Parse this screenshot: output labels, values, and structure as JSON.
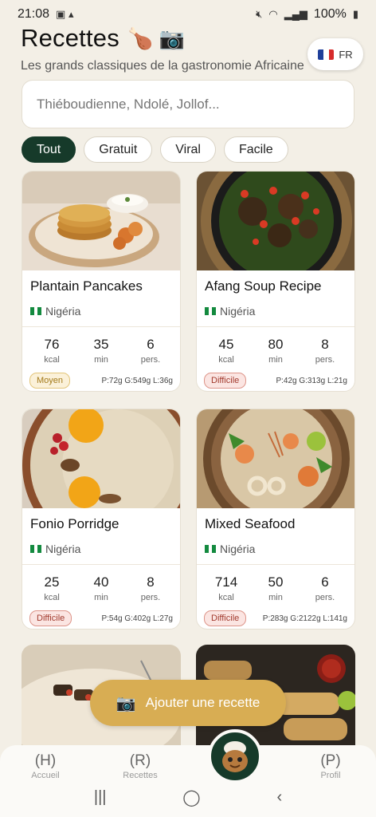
{
  "status_bar": {
    "time": "21:08",
    "battery": "100%"
  },
  "header": {
    "title": "Recettes",
    "title_emoji": "🍗 📷",
    "subtitle": "Les grands classiques de la gastronomie Africaine"
  },
  "language": {
    "code": "FR",
    "flag": "france"
  },
  "search": {
    "placeholder": "Thiéboudienne, Ndolé, Jollof..."
  },
  "filters": [
    {
      "label": "Tout",
      "active": true
    },
    {
      "label": "Gratuit",
      "active": false
    },
    {
      "label": "Viral",
      "active": false
    },
    {
      "label": "Facile",
      "active": false
    }
  ],
  "recipes": [
    {
      "name": "Plantain Pancakes",
      "origin": "Nigéria",
      "kcal": "76",
      "kcal_label": "kcal",
      "min": "35",
      "min_label": "min",
      "pers": "6",
      "pers_label": "pers.",
      "difficulty": "Moyen",
      "difficulty_level": "medium",
      "macros": "P:72g G:549g L:36g"
    },
    {
      "name": "Afang Soup Recipe",
      "origin": "Nigéria",
      "kcal": "45",
      "kcal_label": "kcal",
      "min": "80",
      "min_label": "min",
      "pers": "8",
      "pers_label": "pers.",
      "difficulty": "Difficile",
      "difficulty_level": "hard",
      "macros": "P:42g G:313g L:21g"
    },
    {
      "name": "Fonio Porridge",
      "origin": "Nigéria",
      "kcal": "25",
      "kcal_label": "kcal",
      "min": "40",
      "min_label": "min",
      "pers": "8",
      "pers_label": "pers.",
      "difficulty": "Difficile",
      "difficulty_level": "hard",
      "macros": "P:54g G:402g L:27g"
    },
    {
      "name": "Mixed Seafood",
      "origin": "Nigéria",
      "kcal": "714",
      "kcal_label": "kcal",
      "min": "50",
      "min_label": "min",
      "pers": "6",
      "pers_label": "pers.",
      "difficulty": "Difficile",
      "difficulty_level": "hard",
      "macros": "P:283g G:2122g L:141g"
    }
  ],
  "fab": {
    "label": "Ajouter une recette",
    "icon": "camera-icon"
  },
  "bottom_nav": {
    "items": [
      {
        "icon_text": "(H)",
        "label": "Accueil"
      },
      {
        "icon_text": "(R)",
        "label": "Recettes"
      },
      {
        "icon_text": "(P)",
        "label": "Profil"
      }
    ],
    "center_icon": "chef-mascot-icon"
  },
  "colors": {
    "primary": "#163a2a",
    "accent": "#d8ad53",
    "background": "#f3efe6"
  }
}
